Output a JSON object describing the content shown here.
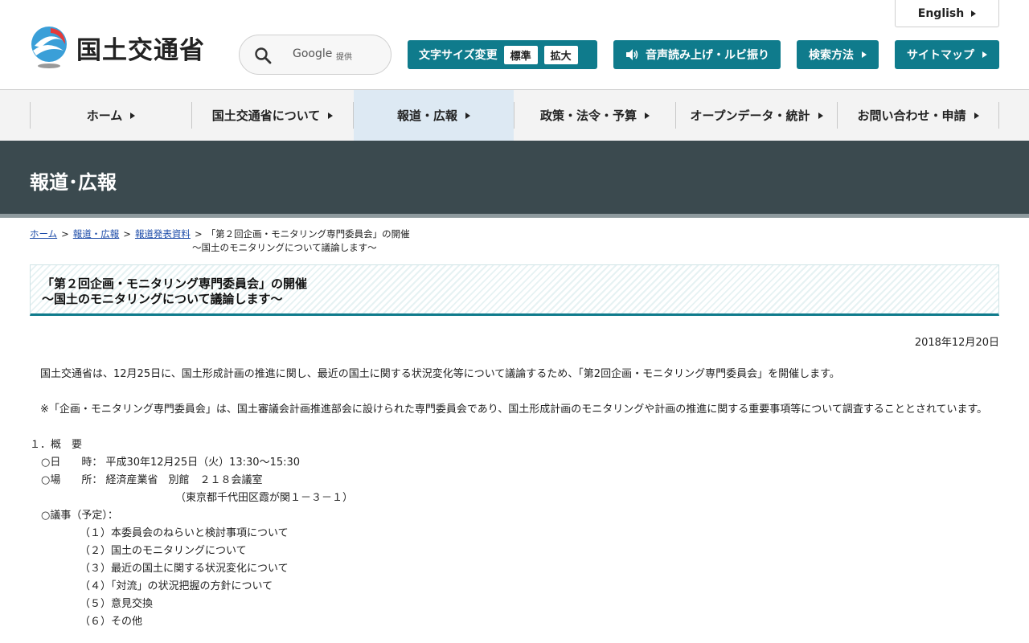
{
  "header": {
    "org_name": "国土交通省",
    "search": {
      "google": "Google",
      "provided": "提供"
    },
    "fontsize": {
      "label": "文字サイズ変更",
      "standard": "標準",
      "large": "拡大"
    },
    "speech_label": "音声読み上げ・ルビ振り",
    "search_method_label": "検索方法",
    "sitemap_label": "サイトマップ",
    "english_label": "English"
  },
  "nav": {
    "items": [
      {
        "label": "ホーム"
      },
      {
        "label": "国土交通省について"
      },
      {
        "label": "報道・広報"
      },
      {
        "label": "政策・法令・予算"
      },
      {
        "label": "オープンデータ・統計"
      },
      {
        "label": "お問い合わせ・申請"
      }
    ]
  },
  "banner": {
    "title": "報道･広報"
  },
  "breadcrumb": {
    "home": "ホーム",
    "press": "報道・広報",
    "releases": "報道発表資料",
    "current_line1": "「第２回企画・モニタリング専門委員会」の開催",
    "current_line2": "～国土のモニタリングについて議論します～",
    "separator": ">"
  },
  "article": {
    "title_line1": "「第２回企画・モニタリング専門委員会」の開催",
    "title_line2": "～国土のモニタリングについて議論します～",
    "date": "2018年12月20日",
    "para1": "国土交通省は、12月25日に、国土形成計画の推進に関し、最近の国土に関する状況変化等について議論するため、「第2回企画・モニタリング専門委員会」を開催します。",
    "para2": "※「企画・モニタリング専門委員会」は、国土審議会計画推進部会に設けられた専門委員会であり、国土形成計画のモニタリングや計画の推進に関する重要事項等について調査することとされています。",
    "section1": "１．概　要",
    "date_line": "○日　　時：  平成30年12月25日（火）13:30～15:30",
    "place_line": "○場　　所：  経済産業省　別館　２１８会議室",
    "place_address": "（東京都千代田区霞が関１－３－１）",
    "agenda_head": "○議事（予定）：",
    "agenda": [
      "（１）本委員会のねらいと検討事項について",
      "（２）国土のモニタリングについて",
      "（３）最近の国土に関する状況変化について",
      "（４）「対流」の状況把握の方針について",
      "（５）意見交換",
      "（６）その他"
    ]
  }
}
